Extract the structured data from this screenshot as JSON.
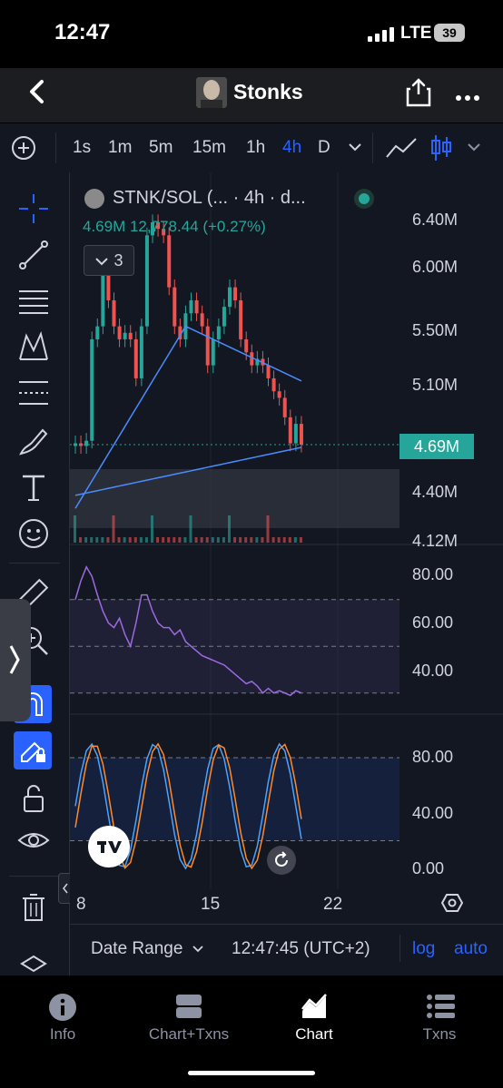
{
  "status_bar": {
    "time": "12:47",
    "network": "LTE",
    "battery": "39"
  },
  "header": {
    "title": "Stonks"
  },
  "toolbar": {
    "timeframes": [
      "1s",
      "1m",
      "5m",
      "15m",
      "1h",
      "4h",
      "D"
    ],
    "active_timeframe": "4h"
  },
  "chart": {
    "legend_name": "STNK/SOL (... · 4h · d...",
    "legend_values": "4.69M  12,778.44 (+0.27%)",
    "collapsed_count": "3",
    "price_axis": [
      "6.40M",
      "6.00M",
      "5.50M",
      "5.10M",
      "4.40M",
      "4.12M"
    ],
    "last_price": "4.69M",
    "rsi_axis": [
      "80.00",
      "60.00",
      "40.00"
    ],
    "stoch_axis": [
      "80.00",
      "40.00",
      "0.00"
    ],
    "dates": [
      "8",
      "15",
      "22"
    ],
    "bottom": {
      "date_range": "Date Range",
      "clock": "12:47:45 (UTC+2)",
      "log": "log",
      "auto": "auto"
    }
  },
  "tabs": [
    {
      "label": "Info",
      "icon": "info-icon"
    },
    {
      "label": "Chart+Txns",
      "icon": "split-view-icon"
    },
    {
      "label": "Chart",
      "icon": "chart-icon"
    },
    {
      "label": "Txns",
      "icon": "list-icon"
    }
  ],
  "active_tab": "Chart",
  "colors": {
    "up": "#26a69a",
    "down": "#ef5350",
    "accent": "#2962ff",
    "ma": "#4a8cff",
    "rsi": "#9c6ade",
    "stoch_k": "#4aa3ff",
    "stoch_d": "#ff8a2a"
  },
  "chart_data": {
    "type": "candlestick",
    "price_axis_ticks": [
      "6.40M",
      "6.00M",
      "5.50M",
      "5.10M",
      "4.40M",
      "4.12M"
    ],
    "x_ticks": [
      "8",
      "15",
      "22"
    ],
    "closes": [
      4.7,
      4.68,
      4.72,
      5.5,
      5.6,
      6.0,
      5.8,
      5.6,
      5.5,
      5.55,
      5.5,
      5.2,
      5.6,
      6.3,
      6.4,
      6.35,
      6.3,
      5.9,
      5.6,
      5.5,
      5.7,
      5.8,
      5.7,
      5.6,
      5.3,
      5.5,
      5.6,
      5.75,
      5.9,
      5.8,
      5.5,
      5.4,
      5.3,
      5.35,
      5.3,
      5.2,
      5.1,
      5.05,
      4.9,
      4.7,
      4.85,
      4.69
    ],
    "rsi": [
      70,
      78,
      84,
      80,
      72,
      65,
      60,
      58,
      62,
      55,
      50,
      60,
      72,
      72,
      65,
      60,
      58,
      58,
      55,
      57,
      52,
      50,
      48,
      46,
      45,
      44,
      43,
      42,
      40,
      38,
      36,
      34,
      35,
      33,
      30,
      32,
      30,
      31,
      30,
      29,
      31,
      30
    ],
    "rsi_ticks": [
      "80.00",
      "60.00",
      "40.00"
    ],
    "stoch_ticks": [
      "80.00",
      "40.00",
      "0.00"
    ]
  }
}
